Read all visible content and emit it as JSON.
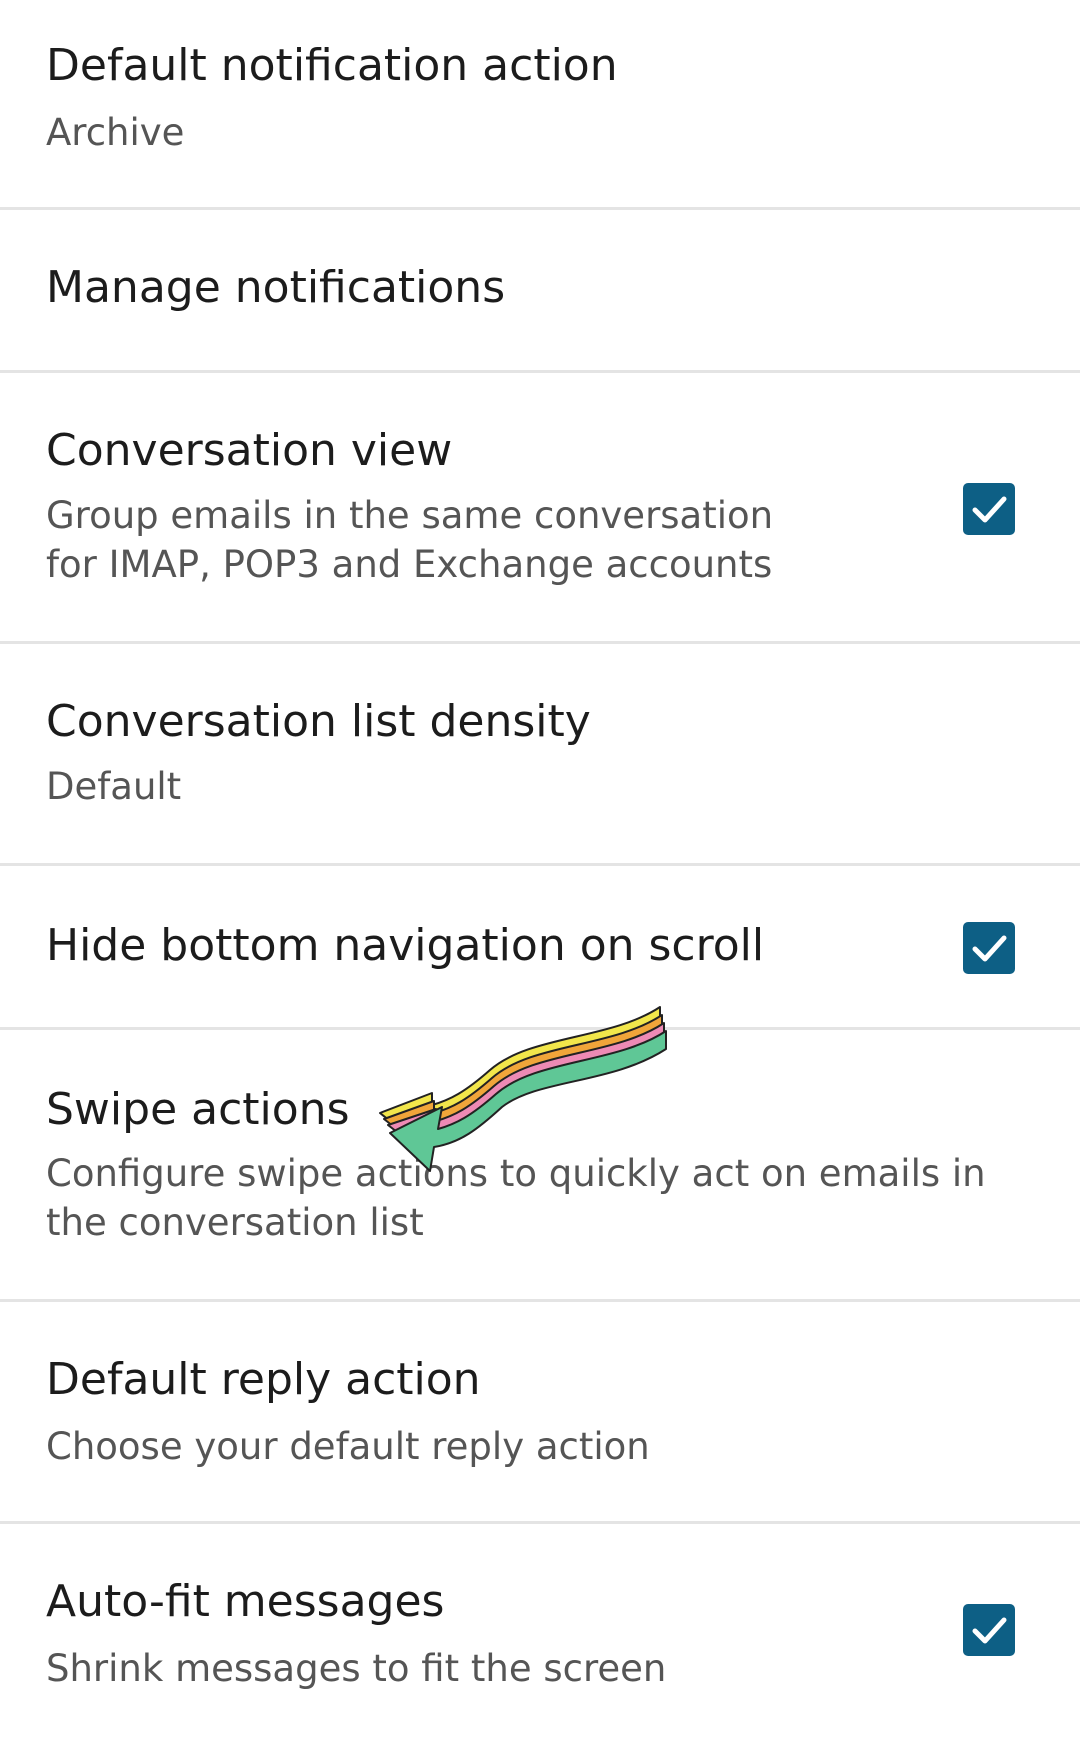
{
  "settings": [
    {
      "title": "Default notification action",
      "summary": "Archive"
    },
    {
      "title": "Manage notifications"
    },
    {
      "title": "Conversation view",
      "summary": "Group emails in the same conversation for IMAP, POP3 and Exchange accounts",
      "checked": true
    },
    {
      "title": "Conversation list density",
      "summary": "Default"
    },
    {
      "title": "Hide bottom navigation on scroll",
      "checked": true
    },
    {
      "title": "Swipe actions",
      "summary": "Configure swipe actions to quickly act on emails in the conversation list"
    },
    {
      "title": "Default reply action",
      "summary": "Choose your default reply action"
    },
    {
      "title": "Auto-fit messages",
      "summary": "Shrink messages to fit the screen",
      "checked": true
    }
  ],
  "colors": {
    "checkbox": "#0d5f85",
    "divider": "#e4e4e4",
    "title_text": "#1c1c1c",
    "summary_text": "#555555"
  }
}
